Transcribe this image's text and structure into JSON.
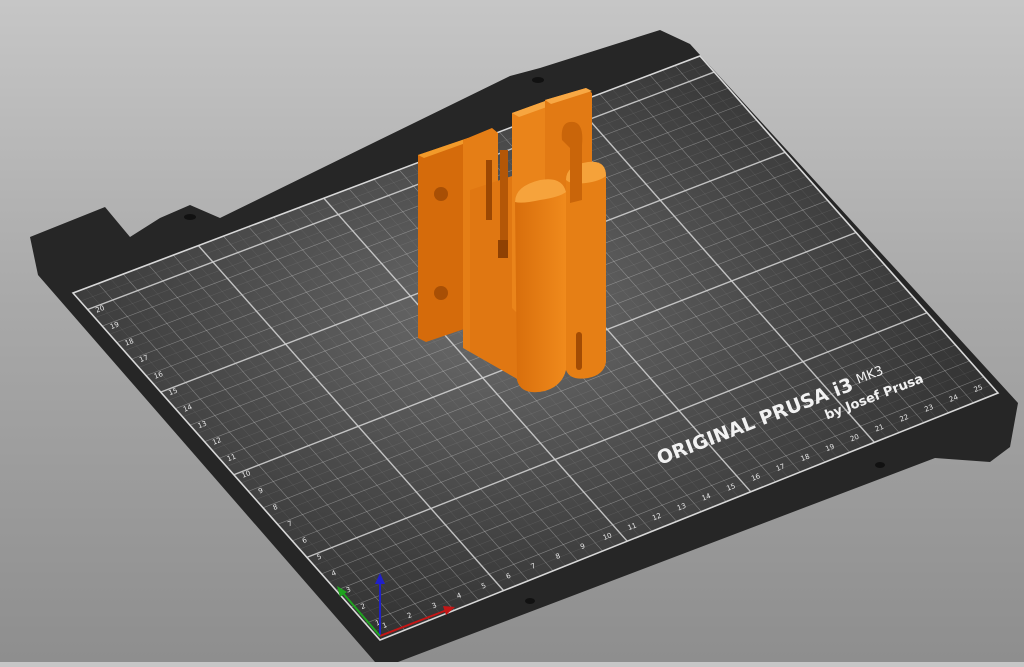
{
  "viewport": {
    "bed": {
      "brand_line": "ORIGINAL PRUSA i3",
      "model_badge": "MK3",
      "byline": "by Josef Prusa",
      "x_axis_labels": [
        "1",
        "2",
        "3",
        "4",
        "5",
        "6",
        "7",
        "8",
        "9",
        "10",
        "11",
        "12",
        "13",
        "14",
        "15",
        "16",
        "17",
        "18",
        "19",
        "20",
        "21",
        "22",
        "23",
        "24",
        "25"
      ],
      "y_axis_labels": [
        "1",
        "2",
        "3",
        "4",
        "5",
        "6",
        "7",
        "8",
        "9",
        "10",
        "11",
        "12",
        "13",
        "14",
        "15",
        "16",
        "17",
        "18",
        "19",
        "20"
      ]
    },
    "model": {
      "color": "#e07a12"
    },
    "axes_gizmo": {
      "x_color": "#c41616",
      "y_color": "#1fa31f",
      "z_color": "#2020c8"
    }
  }
}
